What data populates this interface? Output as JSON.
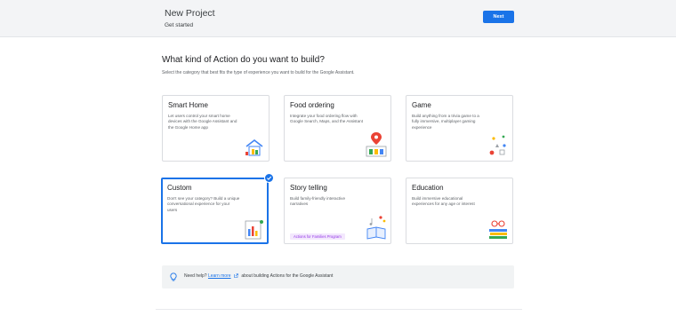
{
  "header": {
    "title": "New Project",
    "subtitle": "Get started",
    "next_label": "Next"
  },
  "main": {
    "heading": "What kind of Action do you want to build?",
    "subheading": "Select the category that best fits the type of experience you want to build for the Google Assistant.",
    "cards": [
      {
        "title": "Smart Home",
        "description": "Let users control your smart home devices with the Google Assistant and the Google Home app",
        "icon": "smart-home-illustration",
        "selected": false
      },
      {
        "title": "Food ordering",
        "description": "Integrate your food ordering flow with Google Search, Maps, and the Assistant",
        "icon": "food-ordering-illustration",
        "selected": false
      },
      {
        "title": "Game",
        "description": "Build anything from a trivia game to a fully immersive, multiplayer gaming experience",
        "icon": "game-illustration",
        "selected": false
      },
      {
        "title": "Custom",
        "description": "Don't see your category? Build a unique conversational experience for your users",
        "icon": "custom-illustration",
        "selected": true
      },
      {
        "title": "Story telling",
        "description": "Build family-friendly interactive narratives",
        "icon": "story-telling-illustration",
        "selected": false,
        "tag": "Actions for Families Program"
      },
      {
        "title": "Education",
        "description": "Build immersive educational experiences for any age or interest",
        "icon": "education-illustration",
        "selected": false
      }
    ]
  },
  "help": {
    "prefix": "Need help?",
    "link_label": "Learn more",
    "suffix": "about building Actions for the Google Assistant"
  },
  "colors": {
    "accent": "#1a73e8",
    "tag_bg": "#f3e8fd",
    "tag_text": "#9334e6",
    "header_bg": "#f3f4f6"
  }
}
